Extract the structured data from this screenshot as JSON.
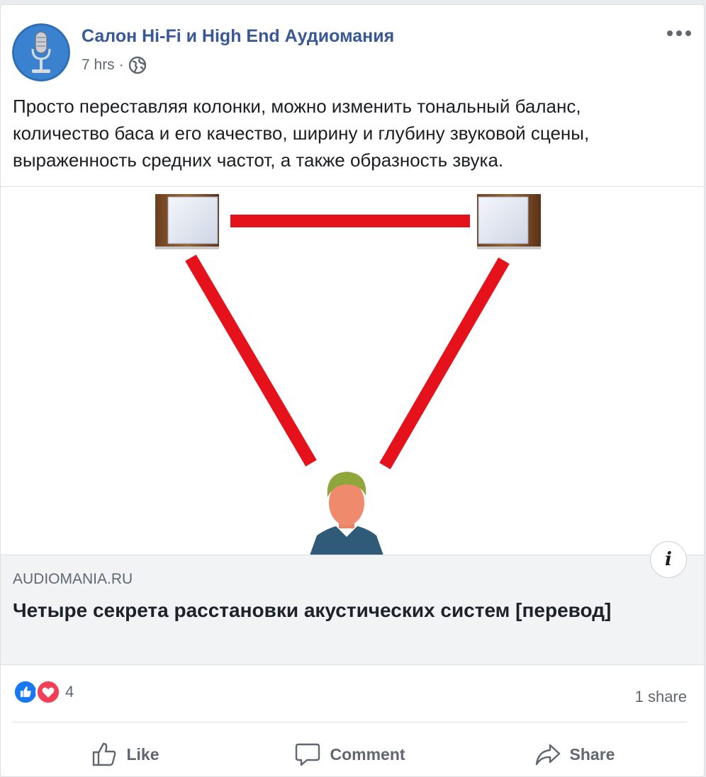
{
  "post": {
    "page_name": "Салон Hi-Fi и High End Аудиомания",
    "time": "7 hrs",
    "separator": "·",
    "privacy_icon": "globe-icon",
    "text_lines": [
      "Просто переставляя колонки, можно изменить тональный баланс,",
      "количество баса и его качество, ширину и глубину звуковой сцены,",
      "выраженность средних частот, а также образность звука."
    ]
  },
  "link": {
    "domain": "AUDIOMANIA.RU",
    "title": "Четыре секрета расстановки акустических систем [перевод]",
    "info_icon": "i"
  },
  "stats": {
    "reaction_icons": [
      "like-icon",
      "love-icon"
    ],
    "reaction_count": "4",
    "shares": "1 share"
  },
  "actions": {
    "like": "Like",
    "comment": "Comment",
    "share": "Share"
  },
  "colors": {
    "accent": "#385898",
    "red_line": "#e5121b",
    "like_blue": "#1877f2",
    "love_red": "#f33e58"
  }
}
